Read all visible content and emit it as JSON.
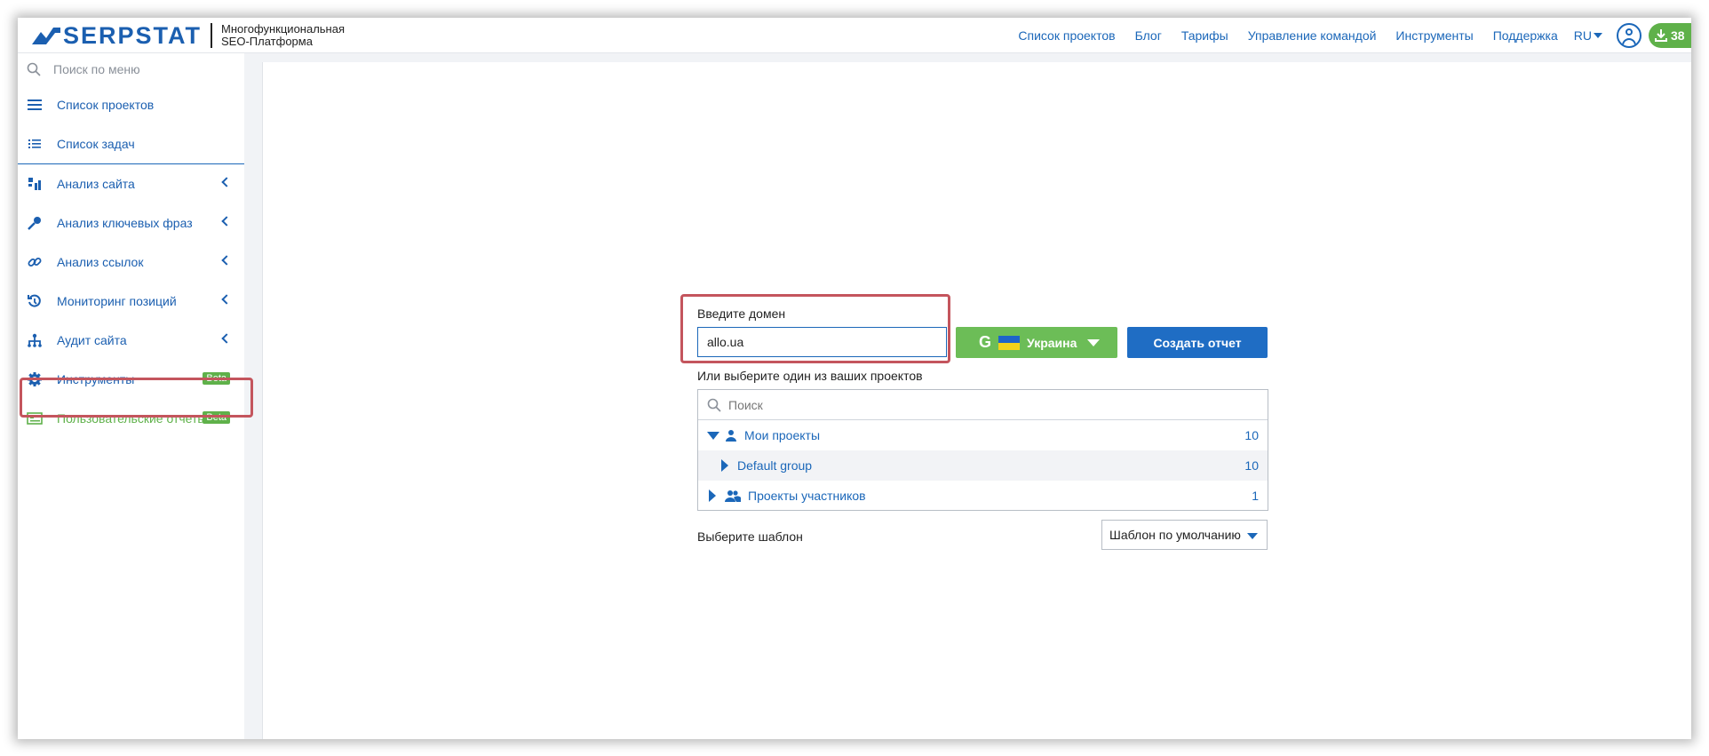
{
  "header": {
    "brand": "SERPSTAT",
    "tagline_line1": "Многофункциональная",
    "tagline_line2": "SEO-Платформа",
    "nav": [
      {
        "label": "Список проектов"
      },
      {
        "label": "Блог"
      },
      {
        "label": "Тарифы"
      },
      {
        "label": "Управление командой"
      },
      {
        "label": "Инструменты"
      },
      {
        "label": "Поддержка"
      }
    ],
    "language": "RU",
    "credits": "38"
  },
  "sidebar": {
    "search_placeholder": "Поиск по меню",
    "items": [
      {
        "label": "Список проектов",
        "icon": "menu-lines-icon"
      },
      {
        "label": "Список задач",
        "icon": "task-list-icon"
      },
      {
        "label": "Анализ сайта",
        "icon": "site-analysis-icon"
      },
      {
        "label": "Анализ ключевых фраз",
        "icon": "key-icon"
      },
      {
        "label": "Анализ ссылок",
        "icon": "link-icon"
      },
      {
        "label": "Мониторинг позиций",
        "icon": "history-icon"
      },
      {
        "label": "Аудит сайта",
        "icon": "sitemap-icon"
      },
      {
        "label": "Инструменты",
        "icon": "gear-icon",
        "badge": "Beta"
      },
      {
        "label": "Пользовательские отчеты",
        "icon": "report-card-icon",
        "badge": "Beta"
      }
    ],
    "colors": {
      "link": "#1b5fb0",
      "active": "#5fb14a",
      "highlight": "#c4555d"
    }
  },
  "form": {
    "domain_label": "Введите домен",
    "domain_value": "allo.ua",
    "region_label": "Украина",
    "search_engine": "G",
    "create_button": "Создать отчет",
    "or_label": "Или выберите один из ваших проектов",
    "projects_search_placeholder": "Поиск",
    "projects": [
      {
        "label": "Мои проекты",
        "count": "10"
      },
      {
        "label": "Default group",
        "count": "10"
      },
      {
        "label": "Проекты участников",
        "count": "1"
      }
    ],
    "template_label": "Выберите шаблон",
    "template_value": "Шаблон по умолчанию"
  }
}
